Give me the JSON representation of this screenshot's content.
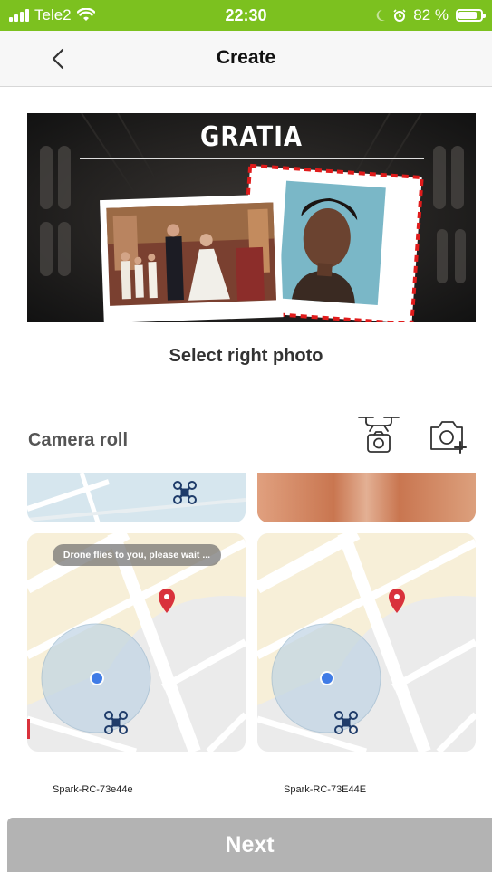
{
  "status_bar": {
    "carrier": "Tele2",
    "time": "22:30",
    "battery": "82 %",
    "battery_level": 0.82,
    "icons": [
      "signal-icon",
      "wifi-icon",
      "moon-icon",
      "alarm-icon",
      "battery-icon"
    ]
  },
  "nav": {
    "title": "Create",
    "back_icon": "chevron-left-icon"
  },
  "preview": {
    "caption": "GRATIA"
  },
  "select_label": "Select right photo",
  "camera_roll": {
    "title": "Camera roll",
    "drone_camera_icon": "drone-camera-icon",
    "camera_icon": "camera-add-icon"
  },
  "thumbnails": {
    "toast": "Drone flies to you, please wait ..."
  },
  "devices": [
    {
      "name": "Spark-RC-73e44e"
    },
    {
      "name": "Spark-RC-73E44E"
    }
  ],
  "next_label": "Next",
  "colors": {
    "status_bar": "#7cc11f",
    "next_button": "#b3b3b3",
    "stamp_border": "#e01b1b",
    "map_pin": "#d9323c",
    "location_dot": "#3f7be6"
  }
}
